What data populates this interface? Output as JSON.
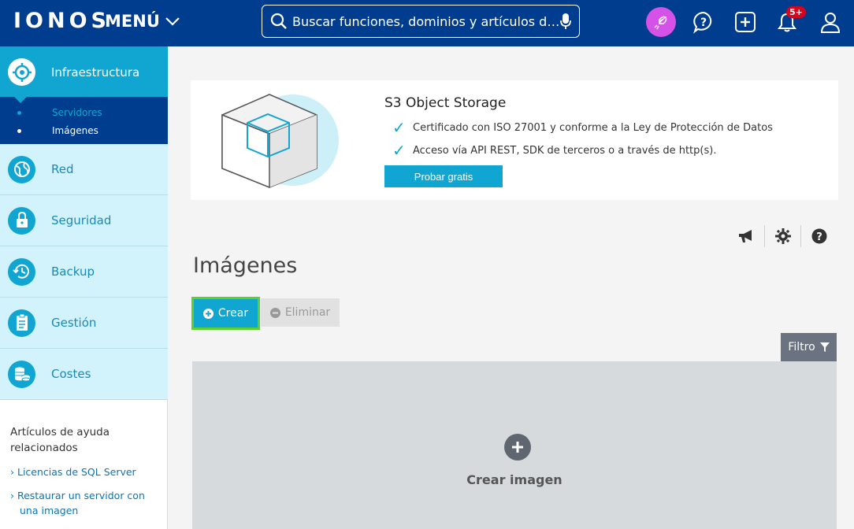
{
  "header": {
    "logo": "IONOS",
    "menu_label": "MENÚ",
    "search_placeholder": "Buscar funciones, dominios y artículos de ...",
    "notifications_badge": "5+"
  },
  "sidebar": {
    "items": [
      {
        "label": "Infraestructura",
        "icon": "infrastructure-icon",
        "active": true
      },
      {
        "label": "Red",
        "icon": "network-globe-icon"
      },
      {
        "label": "Seguridad",
        "icon": "lock-icon"
      },
      {
        "label": "Backup",
        "icon": "backup-clock-icon"
      },
      {
        "label": "Gestión",
        "icon": "clipboard-icon"
      },
      {
        "label": "Costes",
        "icon": "coins-icon"
      }
    ],
    "subitems": [
      {
        "label": "Servidores",
        "active": false
      },
      {
        "label": "Imágenes",
        "active": true
      }
    ],
    "help": {
      "title": "Artículos de ayuda relacionados",
      "links": [
        "Licencias de SQL Server",
        "Restaurar un servidor con una imagen"
      ]
    }
  },
  "promo": {
    "title": "S3 Object Storage",
    "checks": [
      "Certificado con ISO 27001 y conforme a la Ley de Protección de Datos",
      "Acceso vía API REST, SDK de terceros o a través de http(s)."
    ],
    "button": "Probar gratis"
  },
  "main": {
    "title": "Imágenes",
    "create_label": "Crear",
    "delete_label": "Eliminar",
    "filter_label": "Filtro",
    "empty_label": "Crear imagen"
  },
  "colors": {
    "header_bg": "#003d8f",
    "accent": "#11a5d1",
    "highlight": "#5cd02b",
    "rocket": "#d651e8"
  }
}
